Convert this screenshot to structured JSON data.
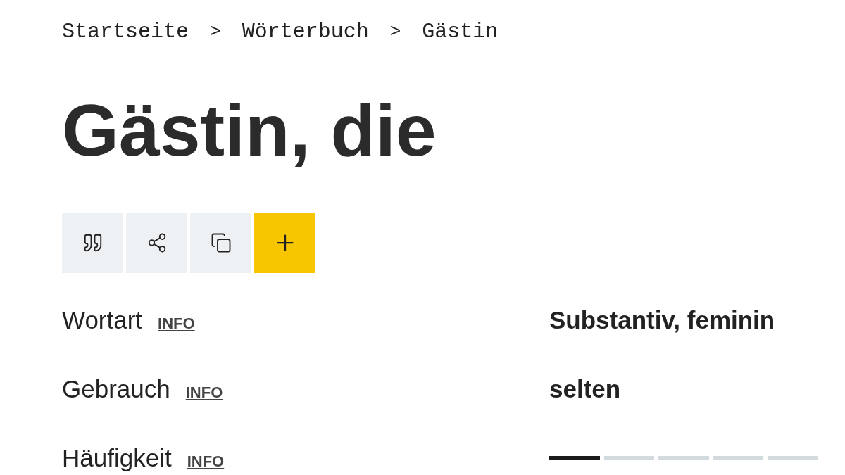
{
  "breadcrumbs": [
    {
      "label": "Startseite"
    },
    {
      "label": ">"
    },
    {
      "label": "Wörterbuch"
    },
    {
      "label": ">"
    },
    {
      "label": "Gästin"
    }
  ],
  "title": "Gästin, die",
  "properties": [
    {
      "kind": "text",
      "label": "Wortart",
      "info": "INFO",
      "value": "Substantiv, feminin"
    },
    {
      "kind": "text",
      "label": "Gebrauch",
      "info": "INFO",
      "value": "selten"
    },
    {
      "kind": "meter",
      "label": "Häufigkeit",
      "info": "INFO",
      "level": 0.2
    }
  ]
}
